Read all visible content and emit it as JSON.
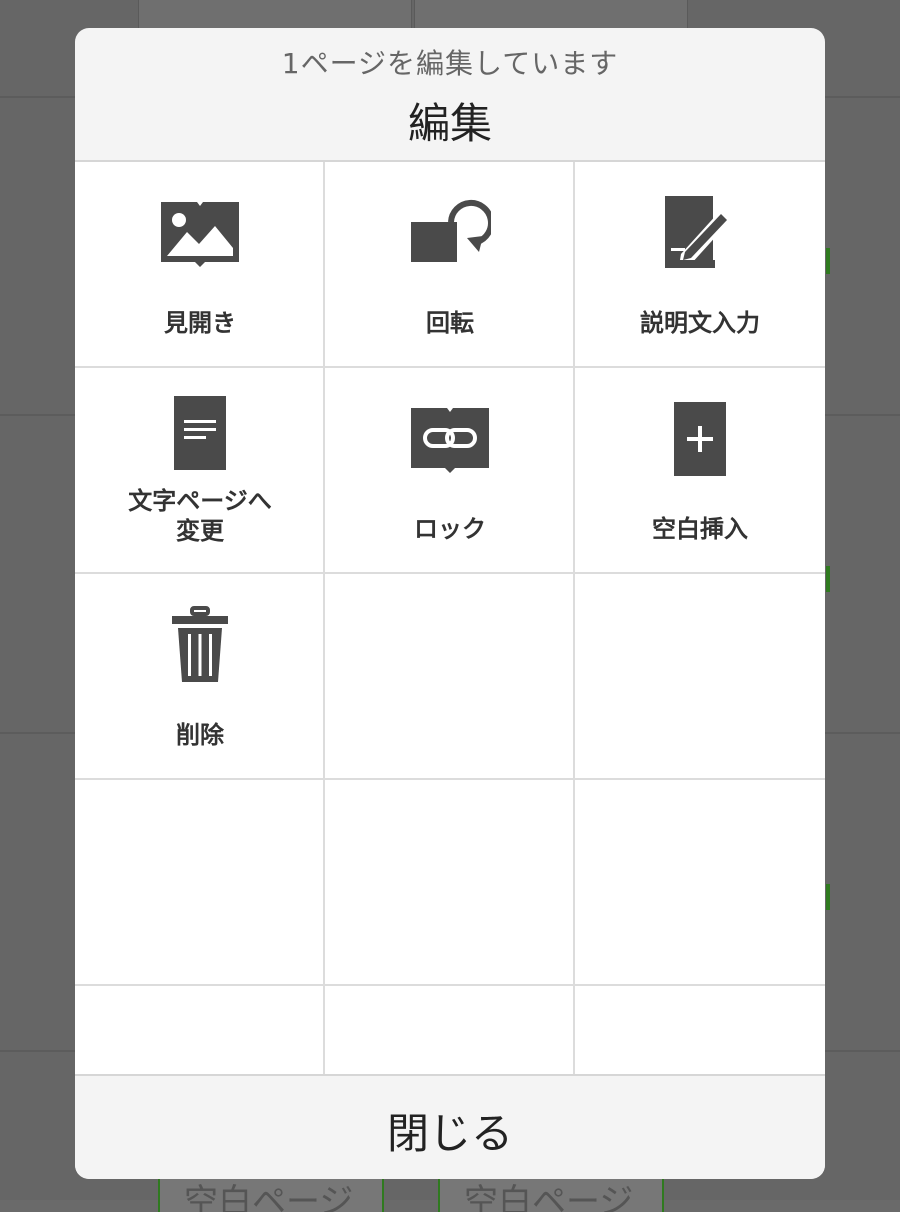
{
  "dialog": {
    "subtitle": "1ページを編集しています",
    "title": "編集",
    "close_label": "閉じる"
  },
  "menu": {
    "spread": {
      "label": "見開き",
      "icon": "image-spread-icon"
    },
    "rotate": {
      "label": "回転",
      "icon": "rotate-icon"
    },
    "caption": {
      "label": "説明文入力",
      "icon": "edit-note-icon"
    },
    "text_page": {
      "label_line1": "文字ページへ",
      "label_line2": "変更",
      "icon": "text-page-icon"
    },
    "lock": {
      "label": "ロック",
      "icon": "link-lock-icon"
    },
    "insert_blank": {
      "label": "空白挿入",
      "icon": "add-page-icon"
    },
    "delete": {
      "label": "削除",
      "icon": "trash-icon"
    }
  },
  "background": {
    "page_label": "空白ページ"
  },
  "colors": {
    "icon": "#4a4a4a",
    "accent_green": "#2f7a1f"
  }
}
